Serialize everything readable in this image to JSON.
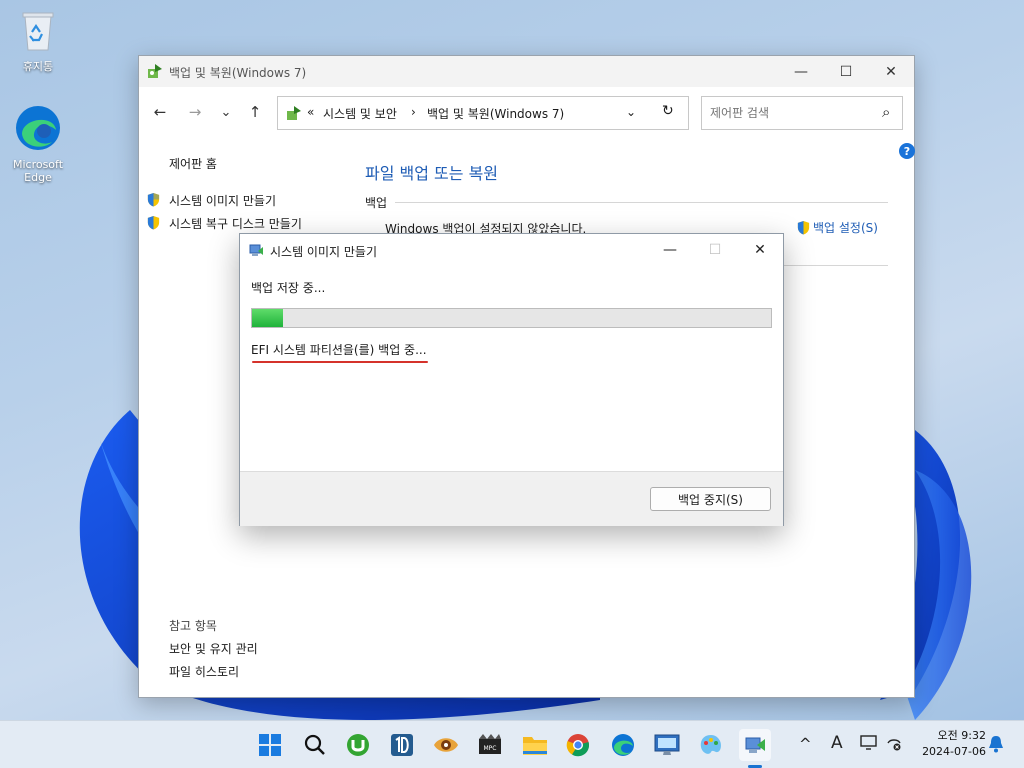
{
  "desktop": {
    "icons": [
      {
        "label": "휴지통",
        "icon": "recycle-bin-icon"
      },
      {
        "label": "Microsoft Edge",
        "icon": "edge-icon"
      }
    ]
  },
  "window": {
    "title": "백업 및 복원(Windows 7)",
    "controls": {
      "minimize": "—",
      "maximize": "☐",
      "close": "✕"
    },
    "nav": {
      "back": "←",
      "forward": "→",
      "recent": "⌄",
      "up": "↑"
    },
    "address": {
      "prefix": "«",
      "crumbs": [
        "시스템 및 보안",
        "백업 및 복원(Windows 7)"
      ],
      "separator": "›",
      "dropdown": "⌄",
      "refresh": "↻"
    },
    "search": {
      "placeholder": "제어판 검색",
      "icon": "⌕"
    },
    "help": "?",
    "sidebar": {
      "home": "제어판 홈",
      "tasks": [
        "시스템 이미지 만들기",
        "시스템 복구 디스크 만들기"
      ],
      "see_also_title": "참고 항목",
      "see_also": [
        "보안 및 유지 관리",
        "파일 히스토리"
      ]
    },
    "main": {
      "heading": "파일 백업 또는 복원",
      "section": "백업",
      "status": "Windows 백업이 설정되지 않았습니다.",
      "setup_link": "백업 설정(S)"
    }
  },
  "dialog": {
    "title": "시스템 이미지 만들기",
    "controls": {
      "minimize": "—",
      "maximize": "☐",
      "close": "✕"
    },
    "saving_text": "백업 저장 중...",
    "progress": 0.06,
    "task_text": "EFI 시스템 파티션을(를) 백업 중...",
    "stop_button": "백업 중지(S)"
  },
  "taskbar": {
    "apps": [
      "start-icon",
      "search-icon",
      "utorrent-icon",
      "1d-app-icon",
      "eye-app-icon",
      "mpc-be-icon",
      "file-explorer-icon",
      "chrome-icon",
      "edge-icon",
      "monitor-app-icon",
      "paint-app-icon",
      "backup-restore-icon"
    ],
    "tray": {
      "overflow": "^",
      "ime": "A"
    },
    "clock": {
      "time": "오전 9:32",
      "date": "2024-07-06"
    }
  },
  "colors": {
    "link": "#1f5db5",
    "progress": "#1fb23a",
    "accent": "#1973d1",
    "annotation": "#d5322b"
  }
}
